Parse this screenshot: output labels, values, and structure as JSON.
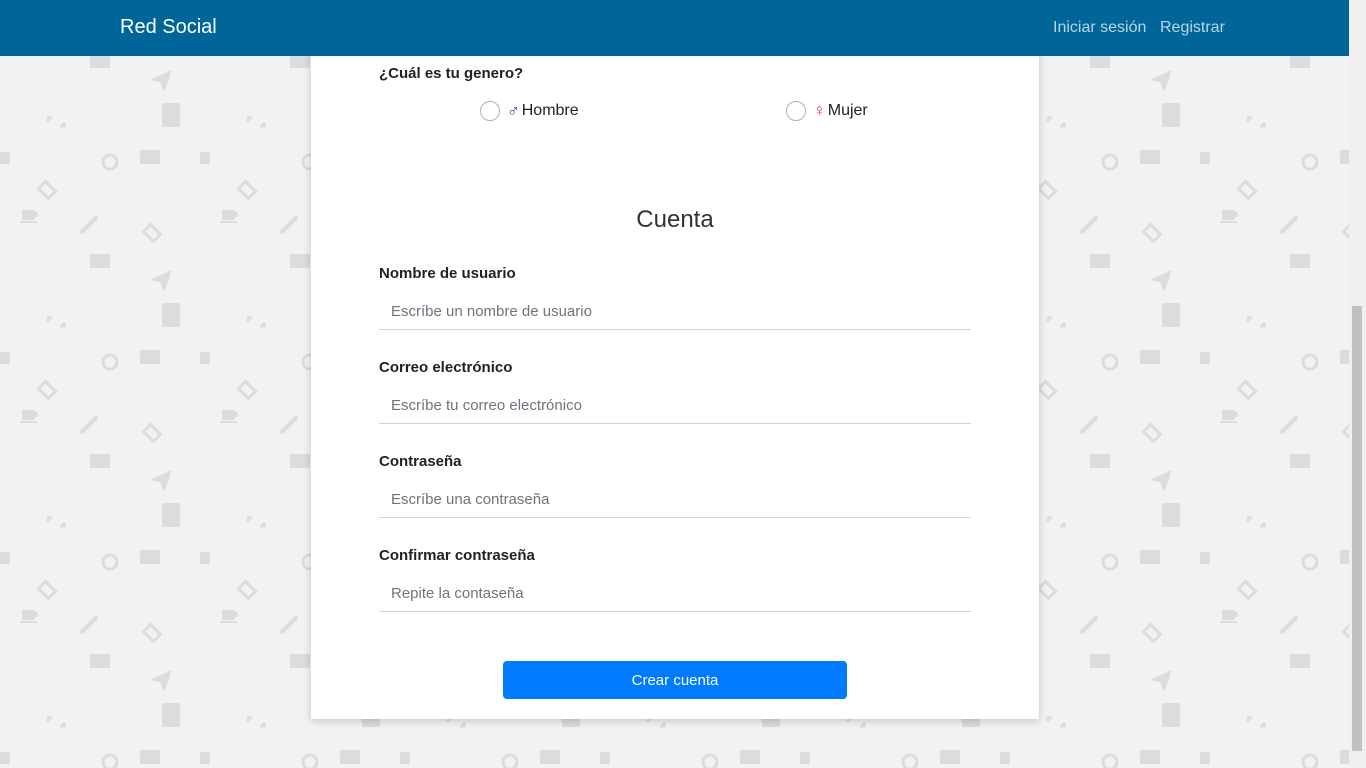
{
  "navbar": {
    "brand": "Red Social",
    "links": [
      "Iniciar sesión",
      "Registrar"
    ]
  },
  "gender": {
    "question": "¿Cuál es tu genero?",
    "options": [
      {
        "symbol": "♂",
        "label": "Hombre",
        "color": "#3333cc"
      },
      {
        "symbol": "♀",
        "label": "Mujer",
        "color": "#e0337a"
      }
    ]
  },
  "account": {
    "title": "Cuenta",
    "fields": [
      {
        "label": "Nombre de usuario",
        "placeholder": "Escríbe un nombre de usuario"
      },
      {
        "label": "Correo electrónico",
        "placeholder": "Escríbe tu correo electrónico"
      },
      {
        "label": "Contraseña",
        "placeholder": "Escríbe una contraseña"
      },
      {
        "label": "Confirmar contraseña",
        "placeholder": "Repite la contaseña"
      }
    ],
    "submit_label": "Crear cuenta"
  },
  "colors": {
    "navbar": "#006699",
    "button": "#007bff",
    "background": "#f2f2f2"
  }
}
